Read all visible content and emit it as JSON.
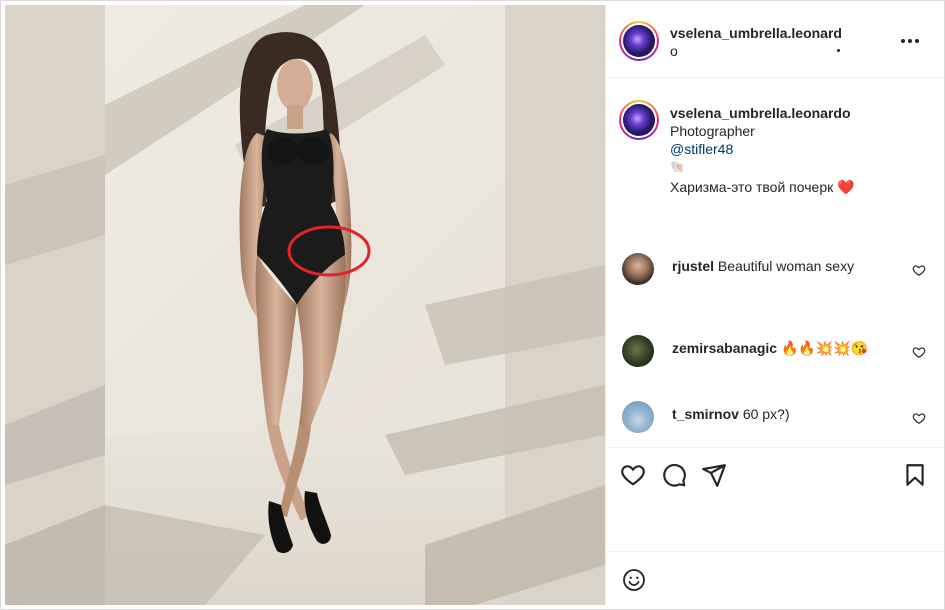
{
  "post": {
    "username": "vselena_umbrella.leonard",
    "subtitle": "o",
    "more_icon": "more-horizontal-icon"
  },
  "caption": {
    "username": "vselena_umbrella.leonardo",
    "text_photographer": "Photographer",
    "mention": "@stifler48",
    "shell_emoji": "🐚",
    "line": "Харизма-это твой почерк",
    "heart": "❤️"
  },
  "comments": [
    {
      "username": "rjustel",
      "text": "Beautiful woman sexy"
    },
    {
      "username": "zemirsabanagic",
      "text": "🔥🔥💥💥😘"
    },
    {
      "username": "t_smirnov",
      "text": "60 px?)"
    }
  ],
  "actions": {
    "like_icon": "heart-outline-icon",
    "comment_icon": "comment-bubble-icon",
    "share_icon": "paper-plane-icon",
    "save_icon": "bookmark-icon"
  },
  "composer": {
    "emoji_icon": "smiley-face-icon"
  },
  "colors": {
    "annotation_circle": "#e0242a",
    "text": "#262626",
    "mention": "#00376b",
    "border": "#efefef"
  }
}
